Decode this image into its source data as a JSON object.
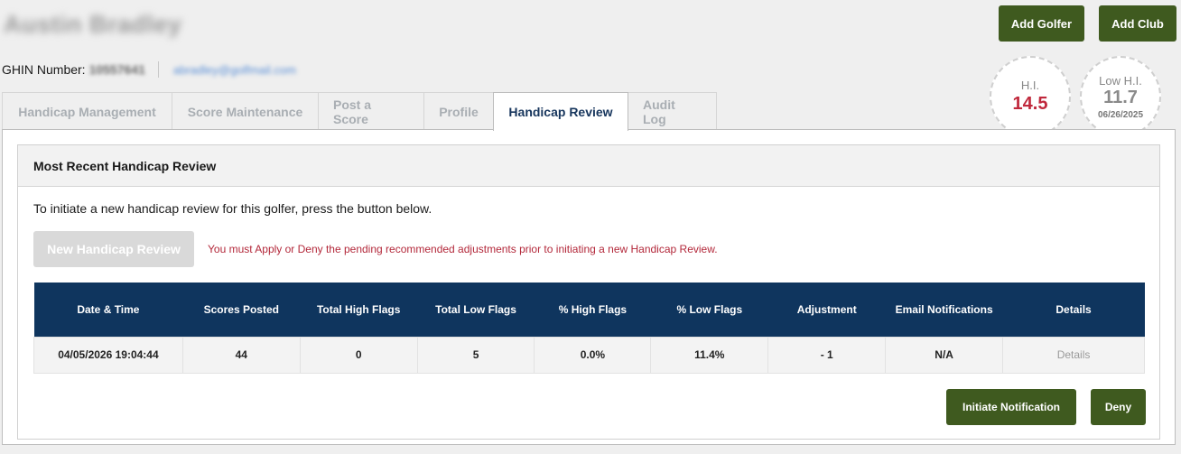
{
  "golfer": {
    "name": "Austin Bradley",
    "ghin_label": "GHIN Number:",
    "ghin_number": "10557641",
    "email": "abradley@golfmail.com"
  },
  "header_buttons": {
    "add_golfer": "Add Golfer",
    "add_club": "Add Club"
  },
  "handicap": {
    "hi_label": "H.I.",
    "hi_value": "14.5",
    "low_label": "Low H.I.",
    "low_value": "11.7",
    "low_date": "06/26/2025"
  },
  "tabs": [
    {
      "label": "Handicap Management"
    },
    {
      "label": "Score Maintenance"
    },
    {
      "label": "Post a Score"
    },
    {
      "label": "Profile"
    },
    {
      "label": "Handicap Review",
      "active": true
    },
    {
      "label": "Audit Log"
    }
  ],
  "review": {
    "title": "Most Recent Handicap Review",
    "intro": "To initiate a new handicap review for this golfer, press the button below.",
    "new_review_button": "New Handicap Review",
    "warning": "You must Apply or Deny the pending recommended adjustments prior to initiating a new Handicap Review.",
    "columns": [
      "Date & Time",
      "Scores Posted",
      "Total High Flags",
      "Total Low Flags",
      "% High Flags",
      "% Low Flags",
      "Adjustment",
      "Email Notifications",
      "Details"
    ],
    "rows": [
      [
        "04/05/2026 19:04:44",
        "44",
        "0",
        "5",
        "0.0%",
        "11.4%",
        "- 1",
        "N/A",
        "Details"
      ]
    ],
    "initiate_button": "Initiate Notification",
    "deny_button": "Deny"
  },
  "colors": {
    "brand_green": "#3f5a1f",
    "table_header_navy": "#0f355e",
    "hi_red": "#c0283c",
    "warning_red": "#b3283a"
  }
}
